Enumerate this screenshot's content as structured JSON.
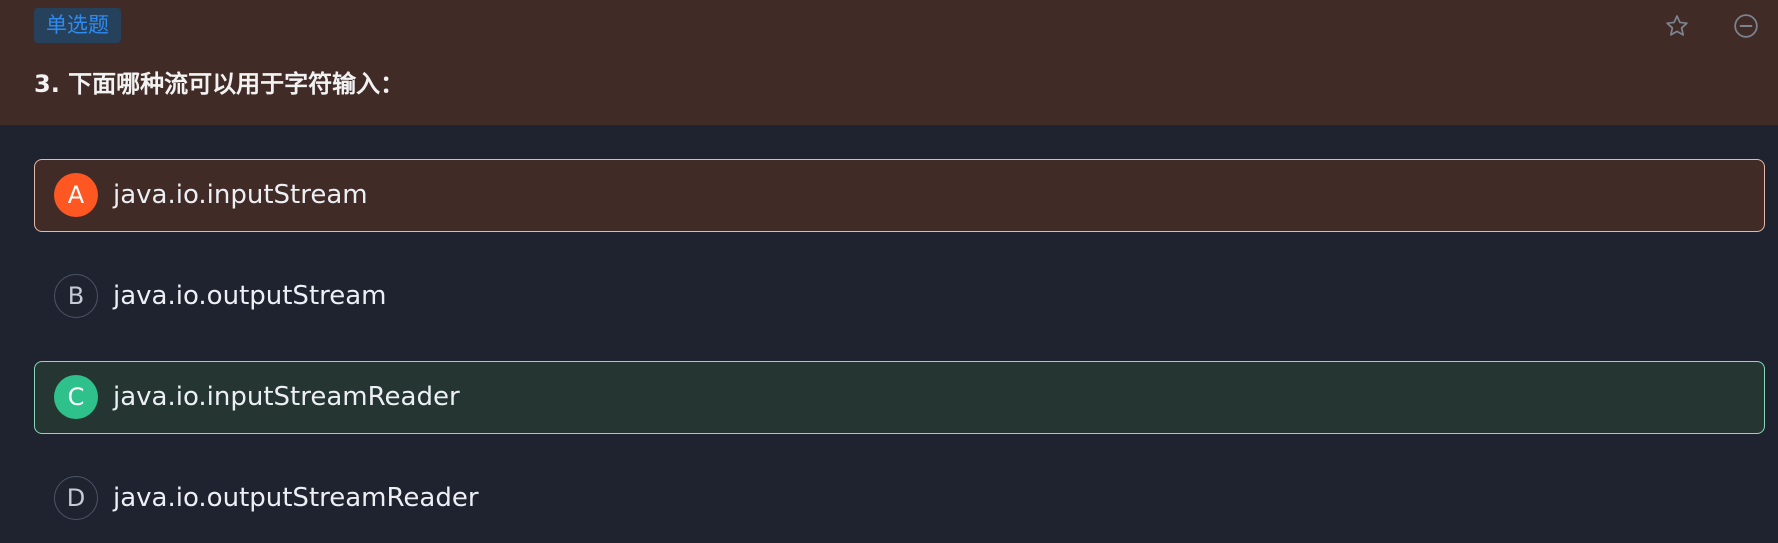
{
  "question": {
    "type_label": "单选题",
    "title": "3. 下面哪种流可以用于字符输入："
  },
  "actions": {
    "favorite_icon": "star-outline",
    "collapse_icon": "minus-circle"
  },
  "options": [
    {
      "letter": "A",
      "text": "java.io.inputStream",
      "state": "selected-wrong"
    },
    {
      "letter": "B",
      "text": "java.io.outputStream",
      "state": "unselected"
    },
    {
      "letter": "C",
      "text": "java.io.inputStreamReader",
      "state": "correct"
    },
    {
      "letter": "D",
      "text": "java.io.outputStreamReader",
      "state": "unselected"
    }
  ],
  "colors": {
    "header_background": "#412b27",
    "page_background": "#1f2330",
    "tag_text": "#2f8bf0",
    "wrong_accent": "#ff5722",
    "correct_accent": "#2fc18c"
  }
}
